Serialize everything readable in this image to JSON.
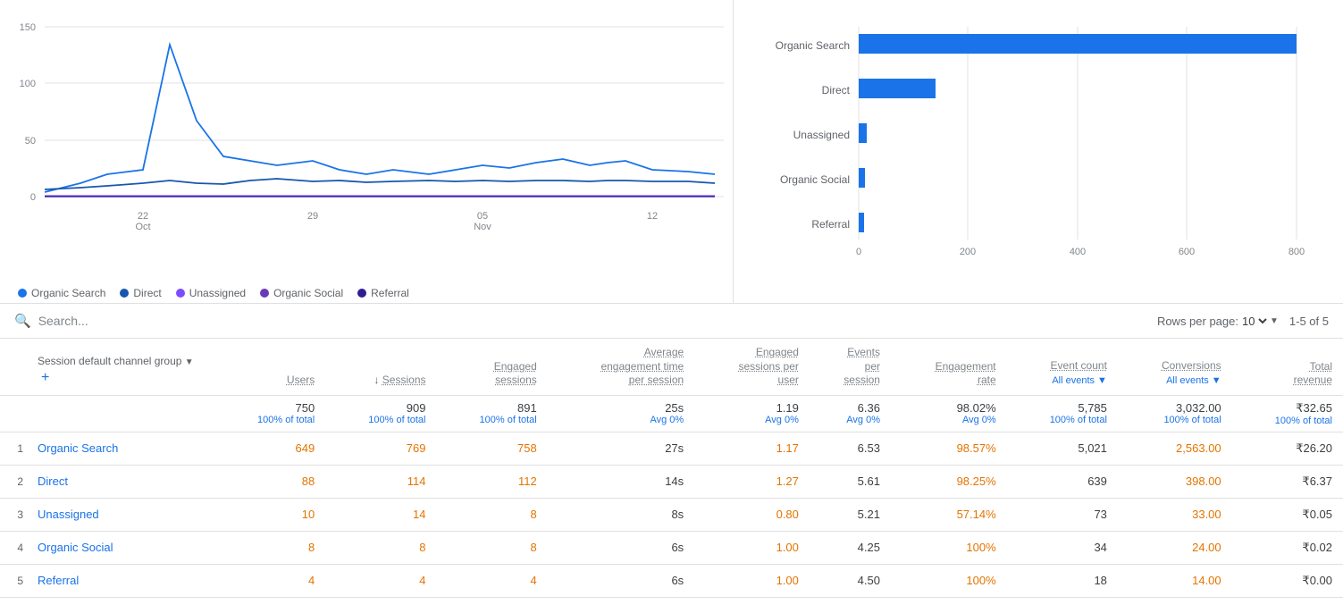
{
  "charts": {
    "line": {
      "x_labels": [
        "22\nOct",
        "29",
        "05\nNov",
        "12"
      ],
      "y_labels": [
        "150",
        "100",
        "50",
        "0"
      ],
      "legend": [
        {
          "label": "Organic Search",
          "color": "#1a73e8"
        },
        {
          "label": "Direct",
          "color": "#1557b0"
        },
        {
          "label": "Unassigned",
          "color": "#7c4dff"
        },
        {
          "label": "Organic Social",
          "color": "#673ab7"
        },
        {
          "label": "Referral",
          "color": "#311b92"
        }
      ]
    },
    "bar": {
      "y_labels": [
        "Organic Search",
        "Direct",
        "Unassigned",
        "Organic Social",
        "Referral"
      ],
      "x_labels": [
        "0",
        "200",
        "400",
        "600",
        "800"
      ],
      "values": [
        800,
        140,
        15,
        12,
        10
      ],
      "color": "#1a73e8"
    }
  },
  "search": {
    "placeholder": "Search...",
    "rows_per_page_label": "Rows per page:",
    "rows_per_page_value": "10",
    "page_info": "1-5 of 5"
  },
  "table": {
    "dimension_col": {
      "label": "Session default channel group",
      "sort_icon": "▼"
    },
    "columns": [
      {
        "key": "users",
        "label": "Users",
        "underline": true
      },
      {
        "key": "sessions",
        "label": "Sessions",
        "underline": true,
        "sort": "↓"
      },
      {
        "key": "engaged_sessions",
        "label": "Engaged\nsessions",
        "underline": true
      },
      {
        "key": "avg_engagement",
        "label": "Average\nengagement time\nper session",
        "underline": true
      },
      {
        "key": "engaged_per_user",
        "label": "Engaged\nsessions per\nuser",
        "underline": true
      },
      {
        "key": "events_per_session",
        "label": "Events\nper\nsession",
        "underline": true
      },
      {
        "key": "engagement_rate",
        "label": "Engagement\nrate",
        "underline": true
      },
      {
        "key": "event_count",
        "label": "Event count",
        "sub": "All events",
        "underline": true
      },
      {
        "key": "conversions",
        "label": "Conversions",
        "sub": "All events",
        "underline": true
      },
      {
        "key": "total_revenue",
        "label": "Total\nrevenue",
        "underline": true
      }
    ],
    "totals": {
      "users": "750",
      "users_sub": "100% of total",
      "sessions": "909",
      "sessions_sub": "100% of total",
      "engaged_sessions": "891",
      "engaged_sessions_sub": "100% of total",
      "avg_engagement": "25s",
      "avg_engagement_sub": "Avg 0%",
      "engaged_per_user": "1.19",
      "engaged_per_user_sub": "Avg 0%",
      "events_per_session": "6.36",
      "events_per_session_sub": "Avg 0%",
      "engagement_rate": "98.02%",
      "engagement_rate_sub": "Avg 0%",
      "event_count": "5,785",
      "event_count_sub": "100% of total",
      "conversions": "3,032.00",
      "conversions_sub": "100% of total",
      "total_revenue": "₹32.65",
      "total_revenue_sub": "100% of total"
    },
    "rows": [
      {
        "num": "1",
        "channel": "Organic Search",
        "users": "649",
        "sessions": "769",
        "engaged_sessions": "758",
        "avg_engagement": "27s",
        "engaged_per_user": "1.17",
        "events_per_session": "6.53",
        "engagement_rate": "98.57%",
        "event_count": "5,021",
        "conversions": "2,563.00",
        "total_revenue": "₹26.20"
      },
      {
        "num": "2",
        "channel": "Direct",
        "users": "88",
        "sessions": "114",
        "engaged_sessions": "112",
        "avg_engagement": "14s",
        "engaged_per_user": "1.27",
        "events_per_session": "5.61",
        "engagement_rate": "98.25%",
        "event_count": "639",
        "conversions": "398.00",
        "total_revenue": "₹6.37"
      },
      {
        "num": "3",
        "channel": "Unassigned",
        "users": "10",
        "sessions": "14",
        "engaged_sessions": "8",
        "avg_engagement": "8s",
        "engaged_per_user": "0.80",
        "events_per_session": "5.21",
        "engagement_rate": "57.14%",
        "event_count": "73",
        "conversions": "33.00",
        "total_revenue": "₹0.05"
      },
      {
        "num": "4",
        "channel": "Organic Social",
        "users": "8",
        "sessions": "8",
        "engaged_sessions": "8",
        "avg_engagement": "6s",
        "engaged_per_user": "1.00",
        "events_per_session": "4.25",
        "engagement_rate": "100%",
        "event_count": "34",
        "conversions": "24.00",
        "total_revenue": "₹0.02"
      },
      {
        "num": "5",
        "channel": "Referral",
        "users": "4",
        "sessions": "4",
        "engaged_sessions": "4",
        "avg_engagement": "6s",
        "engaged_per_user": "1.00",
        "events_per_session": "4.50",
        "engagement_rate": "100%",
        "event_count": "18",
        "conversions": "14.00",
        "total_revenue": "₹0.00"
      }
    ]
  }
}
